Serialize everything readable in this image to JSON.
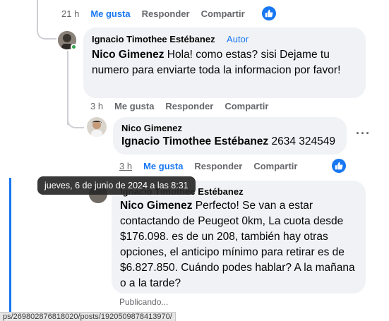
{
  "top_row": {
    "time": "21 h",
    "like": "Me gusta",
    "reply": "Responder",
    "share": "Compartir",
    "liked": true
  },
  "comment1": {
    "author": "Ignacio Timothee Estébanez",
    "tag": "Autor",
    "mention": "Nico Gimenez",
    "text": " Hola! como estas? sisi Dejame tu numero para enviarte toda la informacion por favor!",
    "actions": {
      "time": "3 h",
      "like": "Me gusta",
      "reply": "Responder",
      "share": "Compartir"
    }
  },
  "comment2": {
    "author": "Nico Gimenez",
    "mention": "Ignacio Timothee Estébanez",
    "text": " 2634 324549",
    "actions": {
      "time": "3 h",
      "like": "Me gusta",
      "reply": "Responder",
      "share": "Compartir",
      "liked": true
    }
  },
  "tooltip": {
    "text": "jueves, 6 de junio de 2024 a las 8:31"
  },
  "comment3": {
    "author": "Ignacio Timothee Estébanez",
    "mention": "Nico Gimenez",
    "text": " Perfecto! Se van a estar contactando de Peugeot 0km, La cuota desde $176.098. es de un 208, también hay otras opciones, el anticipo mínimo para retirar es de $6.827.850. Cuándo podes hablar? A la mañana o a la tarde?",
    "status": "Publicando..."
  },
  "statusbar": {
    "url": "ps/269802876818020/posts/1920509878413970/"
  },
  "icons": {
    "like": "thumbs-up-icon",
    "more": "more-options-icon",
    "online": "online-status-icon"
  },
  "colors": {
    "accent": "#1877f2",
    "bubble": "#f0f2f5",
    "online": "#31a24c",
    "muted": "#65676b"
  }
}
